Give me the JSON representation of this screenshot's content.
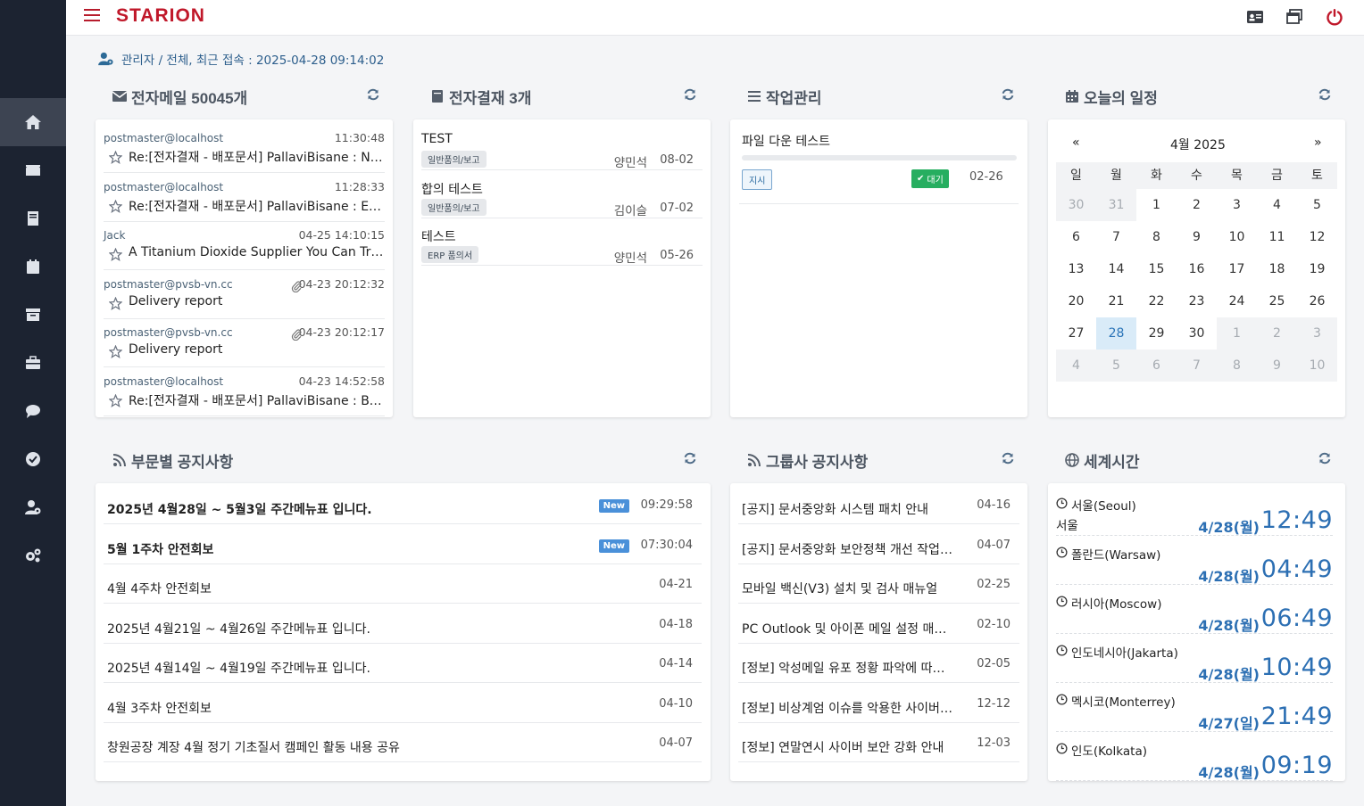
{
  "app": {
    "logo": "STARION"
  },
  "sidebar": {
    "items": [
      {
        "icon": "home-icon"
      },
      {
        "icon": "mail-icon"
      },
      {
        "icon": "book-icon"
      },
      {
        "icon": "calendar-icon"
      },
      {
        "icon": "archive-icon"
      },
      {
        "icon": "briefcase-icon"
      },
      {
        "icon": "chat-icon"
      },
      {
        "icon": "check-circle-icon"
      },
      {
        "icon": "user-settings-icon"
      },
      {
        "icon": "cogs-icon"
      }
    ]
  },
  "topbar": {
    "icons": [
      "id-card-icon",
      "windows-icon",
      "power-icon"
    ]
  },
  "breadcrumb": {
    "role": "관리자",
    "sep": "/",
    "scope": "전체",
    "last_login": ", 최근 접속 : 2025-04-28 09:14:02"
  },
  "mail": {
    "title": "전자메일 50045개",
    "rows": [
      {
        "from": "postmaster@localhost",
        "time": "11:30:48",
        "subject": "Re:[전자결재 - 배포문서] PallaviBisane : New Cu",
        "attachment": false
      },
      {
        "from": "postmaster@localhost",
        "time": "11:28:33",
        "subject": "Re:[전자결재 - 배포문서] PallaviBisane : ECN_ADV",
        "attachment": false
      },
      {
        "from": "Jack",
        "time": "04-25 14:10:15",
        "subject": "A Titanium Dioxide Supplier You Can Trust",
        "attachment": false
      },
      {
        "from": "postmaster@pvsb-vn.cc",
        "time": "04-23 20:12:32",
        "subject": "Delivery report",
        "attachment": true
      },
      {
        "from": "postmaster@pvsb-vn.cc",
        "time": "04-23 20:12:17",
        "subject": "Delivery report",
        "attachment": true
      },
      {
        "from": "postmaster@localhost",
        "time": "04-23 14:52:58",
        "subject": "Re:[전자결재 - 배포문서] PallaviBisane : BOM_ADV",
        "attachment": false
      }
    ]
  },
  "approval": {
    "title": "전자결재 3개",
    "rows": [
      {
        "title": "TEST",
        "tag": "일반품의/보고",
        "name": "양민석",
        "date": "08-02"
      },
      {
        "title": "합의 테스트",
        "tag": "일반품의/보고",
        "name": "김이슬",
        "date": "07-02"
      },
      {
        "title": "테스트",
        "tag": "ERP 품의서",
        "name": "양민석",
        "date": "05-26"
      }
    ]
  },
  "tasks": {
    "title": "작업관리",
    "items": [
      {
        "title": "파일 다운 테스트",
        "label": "지시",
        "status": "대기",
        "date": "02-26",
        "progress": 0
      }
    ]
  },
  "calendar": {
    "title": "오늘의 일정",
    "prev": "«",
    "next": "»",
    "month_label": "4월 2025",
    "dow": [
      "일",
      "월",
      "화",
      "수",
      "목",
      "금",
      "토"
    ],
    "weeks": [
      [
        "30",
        "31",
        "1",
        "2",
        "3",
        "4",
        "5"
      ],
      [
        "6",
        "7",
        "8",
        "9",
        "10",
        "11",
        "12"
      ],
      [
        "13",
        "14",
        "15",
        "16",
        "17",
        "18",
        "19"
      ],
      [
        "20",
        "21",
        "22",
        "23",
        "24",
        "25",
        "26"
      ],
      [
        "27",
        "28",
        "29",
        "30",
        "1",
        "2",
        "3"
      ],
      [
        "4",
        "5",
        "6",
        "7",
        "8",
        "9",
        "10"
      ]
    ],
    "today": "28"
  },
  "dept_notice": {
    "title": "부문별 공지사항",
    "rows": [
      {
        "text": "2025년 4월28일 ~ 5월3일 주간메뉴표 입니다.",
        "badge": "New",
        "date": "09:29:58",
        "bold": true
      },
      {
        "text": "5월 1주차 안전회보",
        "badge": "New",
        "date": "07:30:04",
        "bold": true
      },
      {
        "text": "4월 4주차 안전회보",
        "badge": "",
        "date": "04-21",
        "bold": false
      },
      {
        "text": "2025년 4월21일 ~ 4월26일 주간메뉴표 입니다.",
        "badge": "",
        "date": "04-18",
        "bold": false
      },
      {
        "text": "2025년 4월14일 ~ 4월19일 주간메뉴표 입니다.",
        "badge": "",
        "date": "04-14",
        "bold": false
      },
      {
        "text": "4월 3주차 안전회보",
        "badge": "",
        "date": "04-10",
        "bold": false
      },
      {
        "text": "창원공장 계장 4월 정기 기초질서 캠페인 활동 내용 공유",
        "badge": "",
        "date": "04-07",
        "bold": false
      }
    ]
  },
  "group_notice": {
    "title": "그룹사 공지사항",
    "rows": [
      {
        "text": "[공지] 문서중앙화 시스템 패치 안내",
        "date": "04-16"
      },
      {
        "text": "[공지] 문서중앙화 보안정책 개선 작업 안내",
        "date": "04-07"
      },
      {
        "text": "모바일 백신(V3) 설치 및 검사 매뉴얼",
        "date": "02-25"
      },
      {
        "text": "PC Outlook 및 아이폰 메일 설정 매뉴얼",
        "date": "02-10"
      },
      {
        "text": "[정보] 악성메일 유포 정황 파악에 따른 주의",
        "date": "02-05"
      },
      {
        "text": "[정보] 비상계엄 이슈를 악용한 사이버 공격",
        "date": "12-12"
      },
      {
        "text": "[정보] 연말연시 사이버 보안 강화 안내",
        "date": "12-03"
      }
    ]
  },
  "world_time": {
    "title": "세계시간",
    "rows": [
      {
        "city": "서울(Seoul)",
        "sub": "서울",
        "date": "4/28(월)",
        "time": "12:49"
      },
      {
        "city": "폴란드(Warsaw)",
        "sub": "",
        "date": "4/28(월)",
        "time": "04:49"
      },
      {
        "city": "러시아(Moscow)",
        "sub": "",
        "date": "4/28(월)",
        "time": "06:49"
      },
      {
        "city": "인도네시아(Jakarta)",
        "sub": "",
        "date": "4/28(월)",
        "time": "10:49"
      },
      {
        "city": "멕시코(Monterrey)",
        "sub": "",
        "date": "4/27(일)",
        "time": "21:49"
      },
      {
        "city": "인도(Kolkata)",
        "sub": "",
        "date": "4/28(월)",
        "time": "09:19"
      }
    ]
  },
  "colors": {
    "brand": "#c0182a",
    "sidebar": "#1c2331",
    "accent": "#2c6fb3",
    "new_badge": "#4a90d9",
    "status_green": "#27ae60"
  }
}
